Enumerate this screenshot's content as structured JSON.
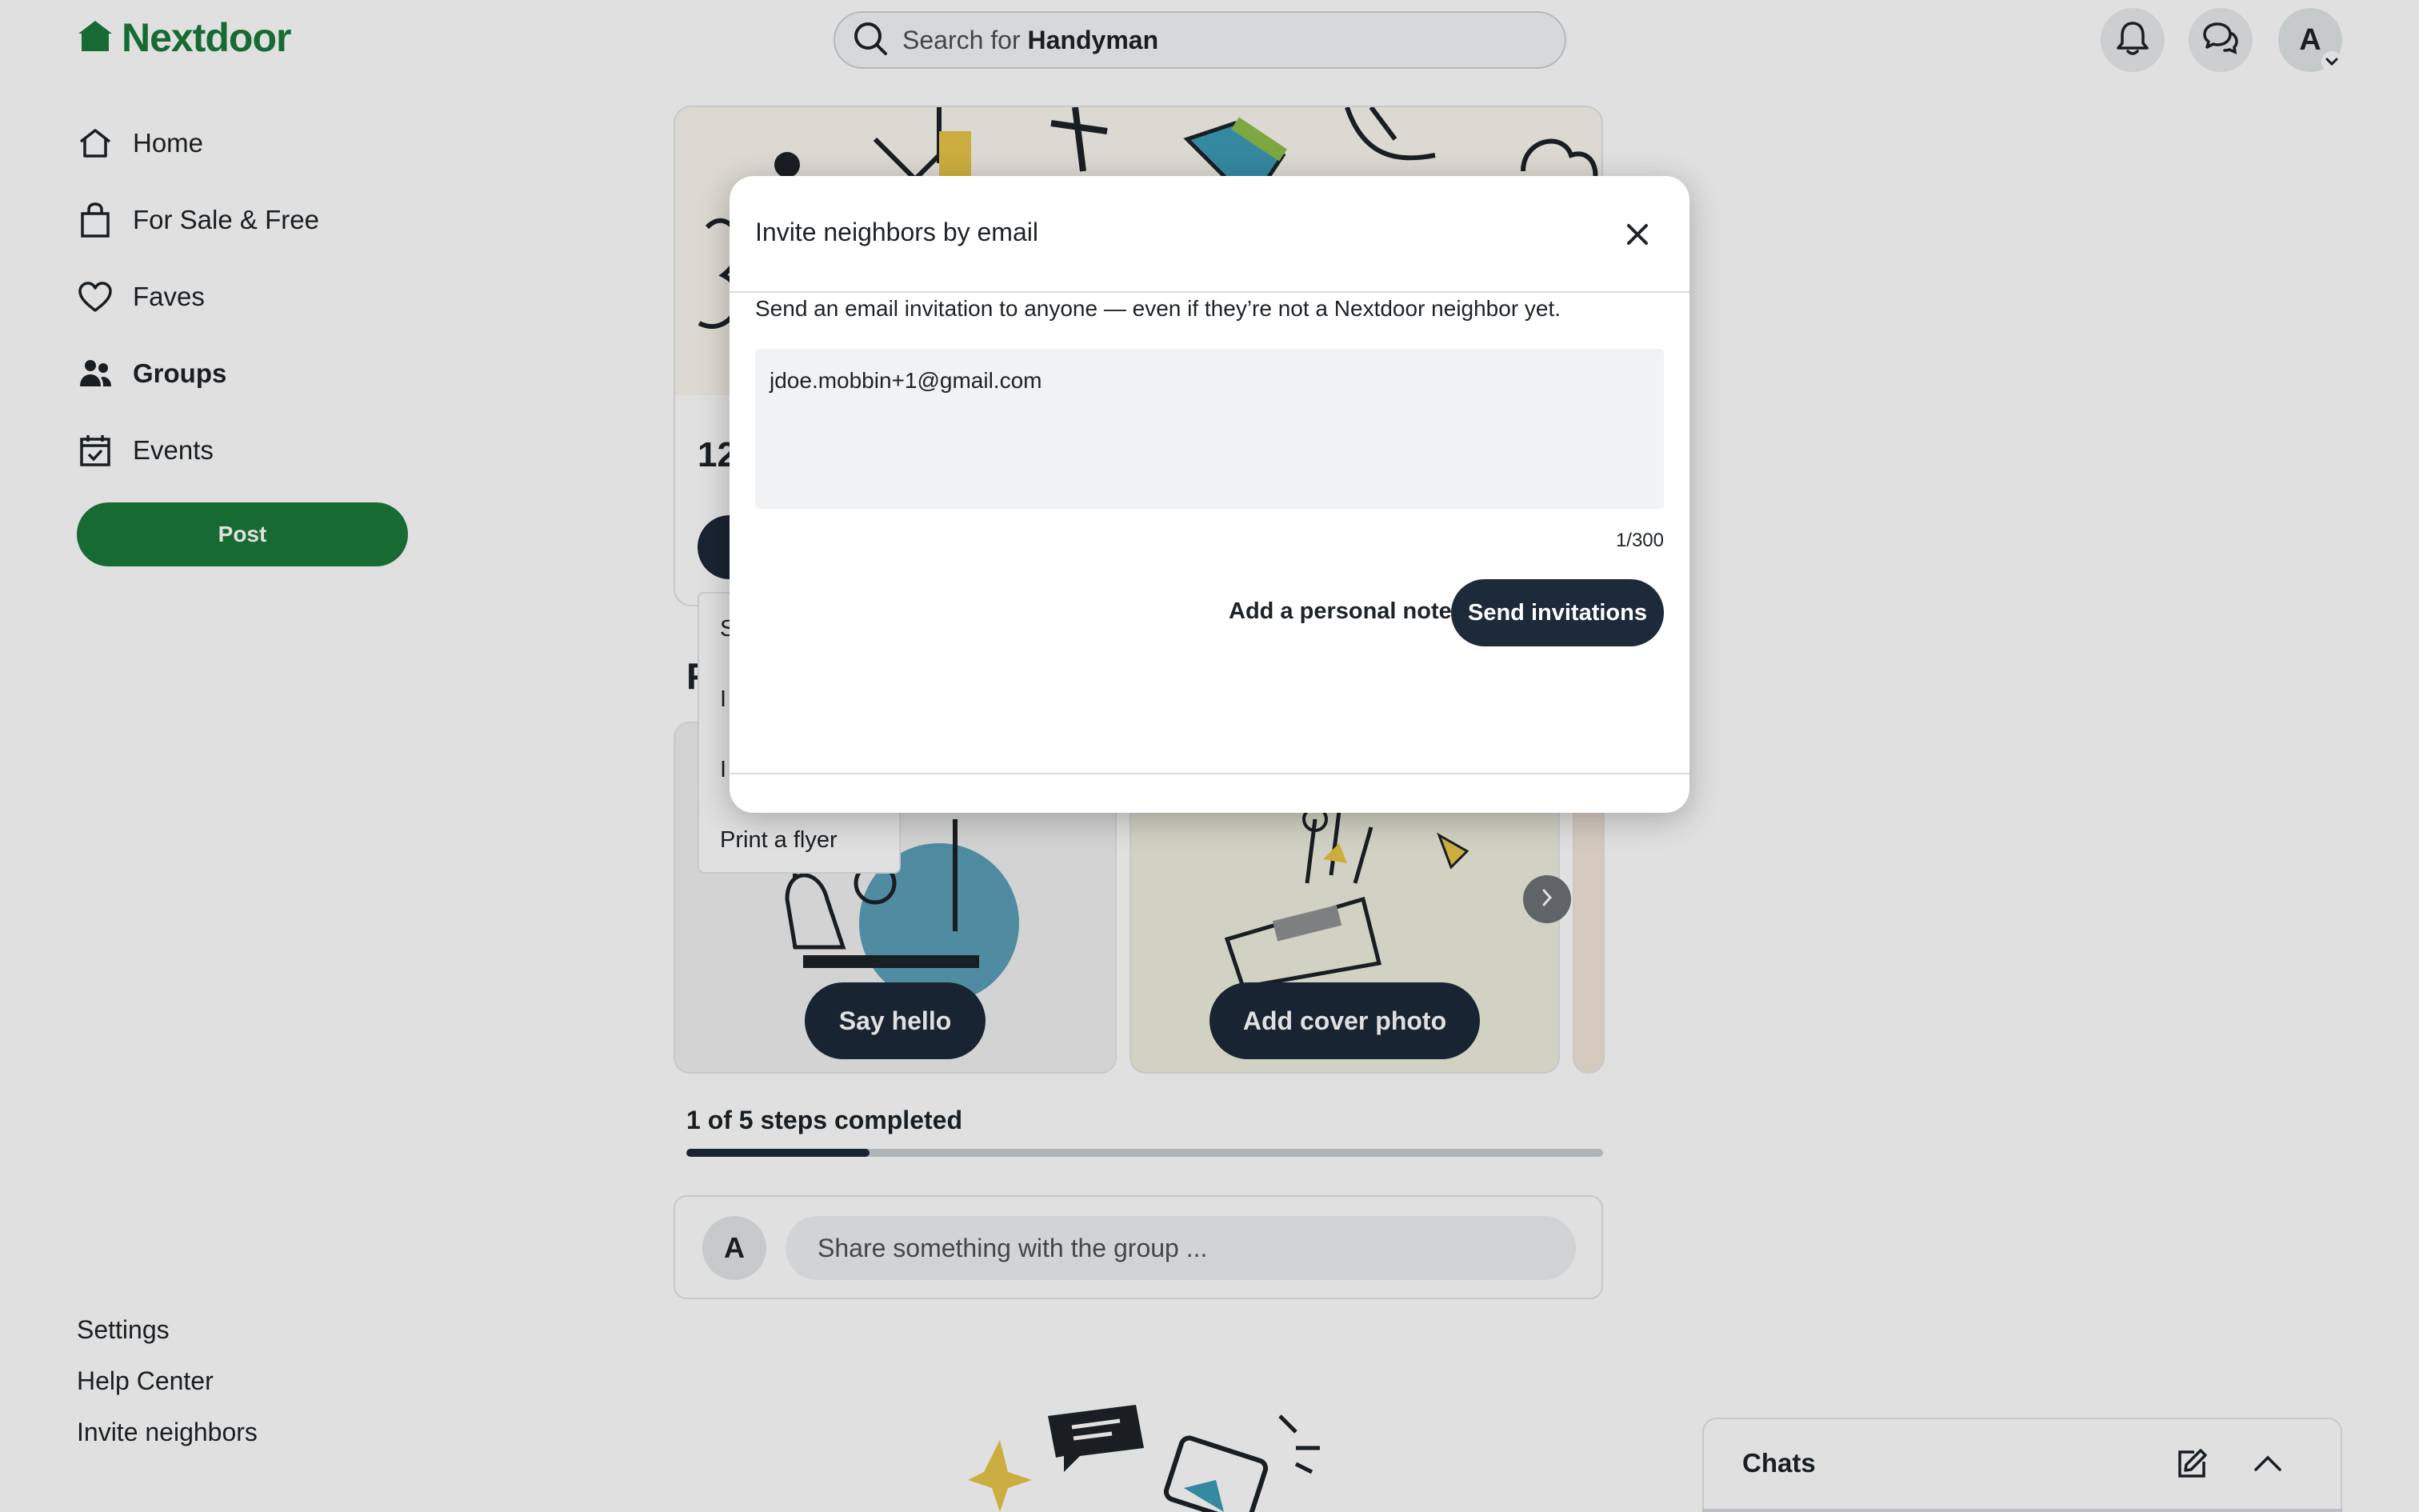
{
  "brand": {
    "name": "Nextdoor",
    "color": "#1b7a3a"
  },
  "search": {
    "prefix": "Search for ",
    "term": "Handyman"
  },
  "topbar": {
    "avatar_initial": "A"
  },
  "sidebar": {
    "items": [
      {
        "label": "Home",
        "icon": "home-icon"
      },
      {
        "label": "For Sale & Free",
        "icon": "shopping-bag-icon"
      },
      {
        "label": "Faves",
        "icon": "heart-icon"
      },
      {
        "label": "Groups",
        "icon": "people-icon",
        "active": true
      },
      {
        "label": "Events",
        "icon": "calendar-icon"
      }
    ],
    "post_label": "Post",
    "footer": [
      "Settings",
      "Help Center",
      "Invite neighbors"
    ]
  },
  "group": {
    "member_count_partial": "12",
    "section_letter_partial": "F",
    "share_menu": {
      "items": [
        "S",
        "I",
        "I",
        "Print a flyer"
      ]
    },
    "cards": [
      {
        "button": "Say hello"
      },
      {
        "button": "Add cover photo"
      }
    ],
    "steps": {
      "label": "1 of 5 steps completed",
      "completed": 1,
      "total": 5
    },
    "composer": {
      "avatar_initial": "A",
      "placeholder": "Share something with the group ..."
    }
  },
  "chats": {
    "title": "Chats"
  },
  "modal": {
    "title": "Invite neighbors by email",
    "description": "Send an email invitation to anyone — even if they’re not a Nextdoor neighbor yet.",
    "email_value": "jdoe.mobbin+1@gmail.com",
    "counter": "1/300",
    "note_label": "Add a personal note",
    "send_label": "Send invitations"
  },
  "colors": {
    "dark_button": "#1d2a3a",
    "brand_green": "#1b7a3a"
  }
}
